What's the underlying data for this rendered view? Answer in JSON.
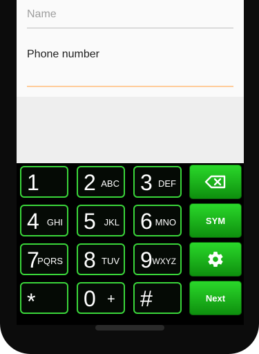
{
  "form": {
    "name_placeholder": "Name",
    "phone_label": "Phone number",
    "phone_value": ""
  },
  "keypad": {
    "keys": [
      {
        "digit": "1",
        "letters": ""
      },
      {
        "digit": "2",
        "letters": "ABC"
      },
      {
        "digit": "3",
        "letters": "DEF"
      },
      {
        "digit": "4",
        "letters": "GHI"
      },
      {
        "digit": "5",
        "letters": "JKL"
      },
      {
        "digit": "6",
        "letters": "MNO"
      },
      {
        "digit": "7",
        "letters": "PQRS"
      },
      {
        "digit": "8",
        "letters": "TUV"
      },
      {
        "digit": "9",
        "letters": "WXYZ"
      },
      {
        "digit": "*",
        "letters": ""
      },
      {
        "digit": "0",
        "letters": "+"
      },
      {
        "digit": "#",
        "letters": ""
      }
    ],
    "function_keys": {
      "backspace_icon": "backspace-icon",
      "sym_label": "SYM",
      "settings_icon": "gear-icon",
      "next_label": "Next"
    }
  },
  "colors": {
    "key_border": "#3ad63a",
    "function_key": "#1fbf1f",
    "input_underline_active": "#ffcc99"
  }
}
